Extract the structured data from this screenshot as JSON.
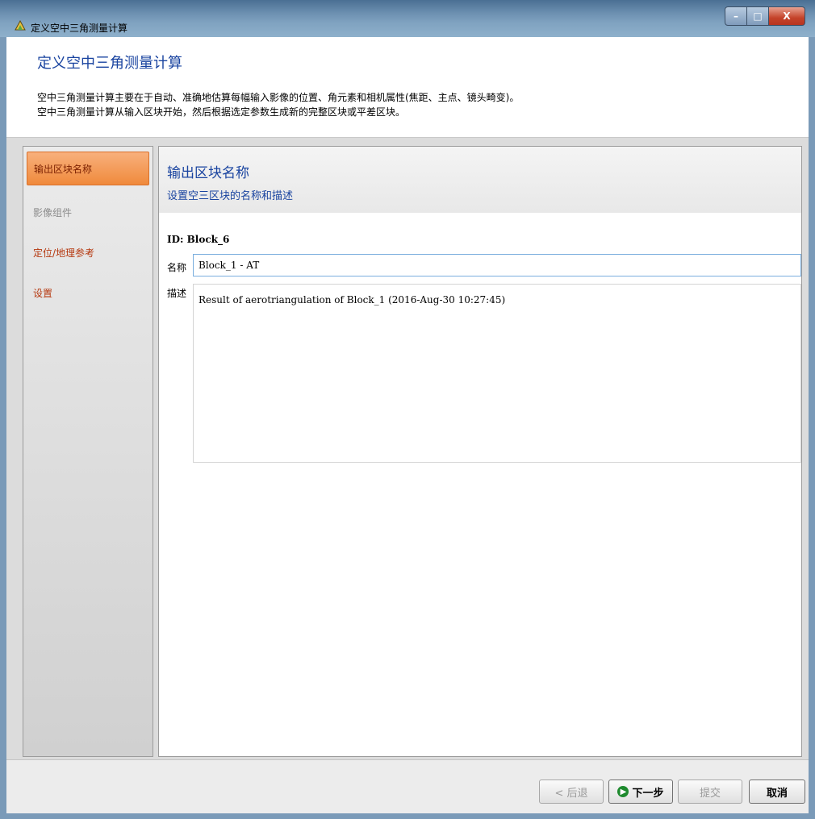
{
  "window": {
    "title": "定义空中三角测量计算",
    "min_glyph": "–",
    "max_glyph": "□",
    "close_glyph": "X"
  },
  "header": {
    "title": "定义空中三角测量计算",
    "line1": "空中三角测量计算主要在于自动、准确地估算每幅输入影像的位置、角元素和相机属性(焦距、主点、镜头畸变)。",
    "line2": "空中三角测量计算从输入区块开始，然后根据选定参数生成新的完整区块或平差区块。"
  },
  "sidebar": {
    "items": [
      {
        "label": "输出区块名称",
        "state": "active"
      },
      {
        "label": "影像组件",
        "state": "disabled"
      },
      {
        "label": "定位/地理参考",
        "state": "normal"
      },
      {
        "label": "设置",
        "state": "normal"
      }
    ]
  },
  "main": {
    "title": "输出区块名称",
    "subtitle": "设置空三区块的名称和描述",
    "id_text": "ID: Block_6",
    "name_label": "名称",
    "name_value": "Block_1 - AT",
    "desc_label": "描述",
    "desc_value": "Result of aerotriangulation of Block_1 (2016-Aug-30 10:27:45)"
  },
  "footer": {
    "back_label": "< 后退",
    "next_label": "下一步",
    "submit_label": "提交",
    "cancel_label": "取消"
  },
  "colors": {
    "accent_blue": "#1a44a0",
    "active_orange": "#f08a3c",
    "link_red": "#b5380f"
  }
}
